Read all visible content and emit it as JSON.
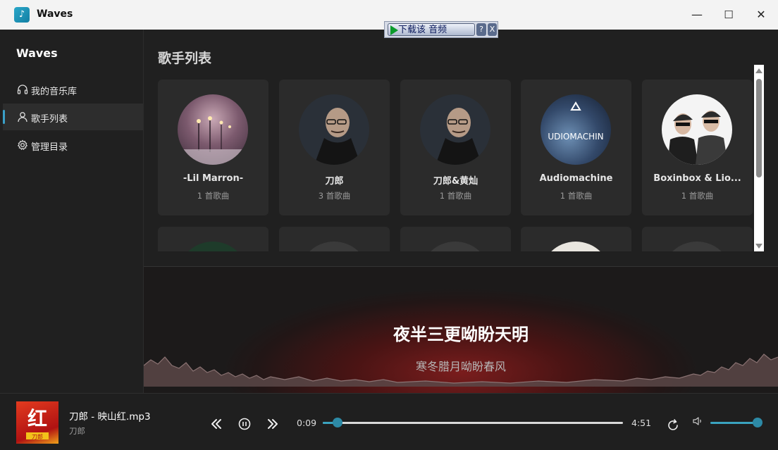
{
  "window": {
    "title": "Waves",
    "icon": "music-note-icon",
    "minimize": "—",
    "maximize": "☐",
    "close": "✕"
  },
  "download_toolbar": {
    "label": "下载该 音频",
    "help": "?",
    "close": "X"
  },
  "sidebar": {
    "brand": "Waves",
    "items": [
      {
        "label": "我的音乐库",
        "icon": "headphones-icon",
        "active": false
      },
      {
        "label": "歌手列表",
        "icon": "user-icon",
        "active": true
      },
      {
        "label": "管理目录",
        "icon": "gear-icon",
        "active": false
      }
    ]
  },
  "main": {
    "title": "歌手列表",
    "artists": [
      {
        "name": "-Lil Marron-",
        "count": "1 首歌曲"
      },
      {
        "name": "刀郎",
        "count": "3 首歌曲"
      },
      {
        "name": "刀郎&黄灿",
        "count": "1 首歌曲"
      },
      {
        "name": "Audiomachine",
        "count": "1 首歌曲",
        "avatar_text": "UDIOMACHIN"
      },
      {
        "name": "Boxinbox & Lio...",
        "count": "1 首歌曲"
      }
    ]
  },
  "lyrics": {
    "current": "夜半三更呦盼天明",
    "next": "寒冬腊月呦盼春风"
  },
  "player": {
    "song": "刀郎 - 映山红.mp3",
    "artist": "刀郎",
    "cover_text": "红",
    "cover_sub": "刀郎",
    "elapsed": "0:09",
    "total": "4:51",
    "progress": 0.05,
    "volume": 1.0,
    "accent": "#3aa3bf"
  }
}
